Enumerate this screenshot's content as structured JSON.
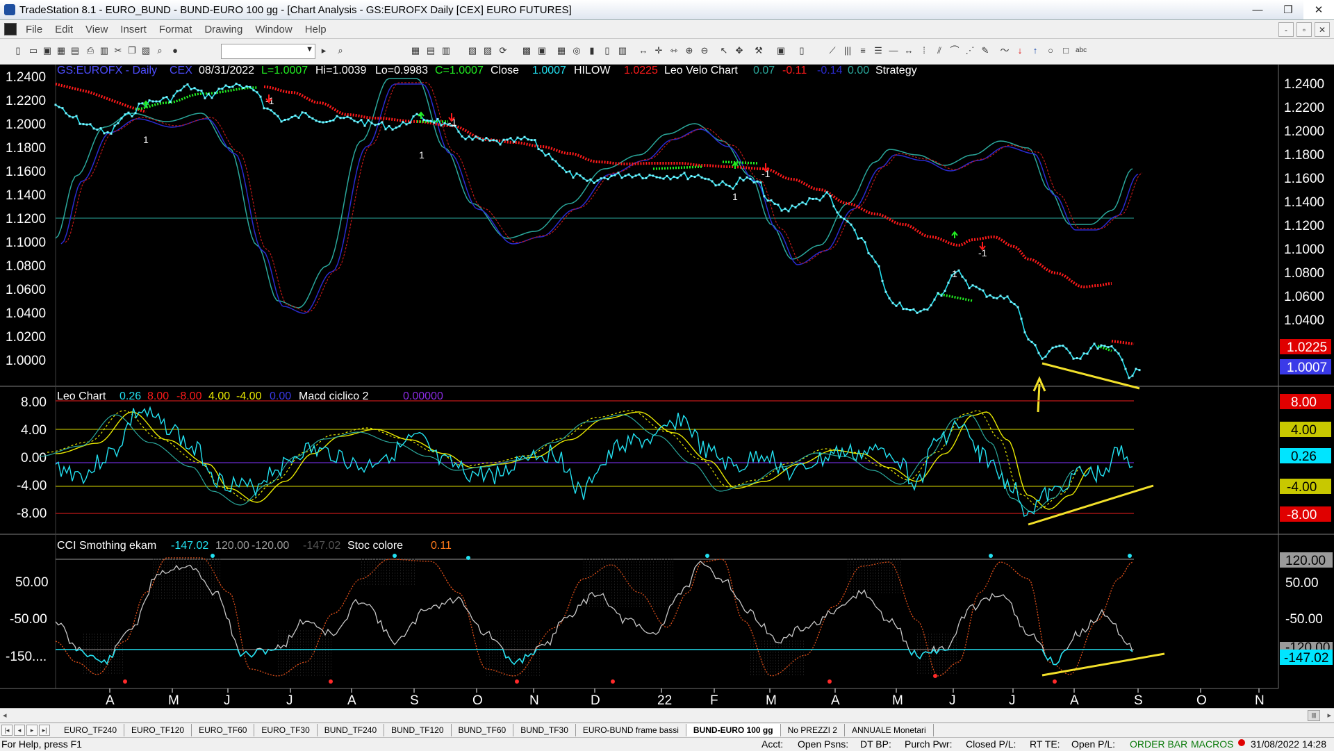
{
  "window": {
    "title": "TradeStation 8.1 - EURO_BUND - BUND-EURO 100 gg - [Chart Analysis - GS:EUROFX  Daily  [CEX] EURO FUTURES]",
    "min": "—",
    "max": "❐",
    "close": "✕"
  },
  "menu": [
    "File",
    "Edit",
    "View",
    "Insert",
    "Format",
    "Drawing",
    "Window",
    "Help"
  ],
  "mdi_buttons": [
    "-",
    "▫",
    "✕"
  ],
  "chart": {
    "header": {
      "symbol": "GS:EUROFX - Daily",
      "exchange": "CEX",
      "date": "08/31/2022",
      "L": "L=1.0007",
      "Hi": "Hi=1.0039",
      "Lo": "Lo=0.9983",
      "C": "C=1.0007",
      "close_label": "Close",
      "close_value": "1.0007",
      "hilow_label": "HILOW",
      "hilow_value": "1.0225",
      "velo_label": "Leo Velo Chart",
      "velo_v1": "0.07",
      "velo_v2": "-0.11",
      "velo_v3": "-0.14",
      "velo_v4": "0.00",
      "strategy": "Strategy"
    },
    "price_axis": [
      "1.2400",
      "1.2200",
      "1.2000",
      "1.1800",
      "1.1600",
      "1.1400",
      "1.1200",
      "1.1000",
      "1.0800",
      "1.0600",
      "1.0400",
      "1.0200",
      "1.0000"
    ],
    "price_markers": [
      {
        "label": "1.0225",
        "color": "#e00000",
        "text_color": "#ffffff"
      },
      {
        "label": "1.0007",
        "color": "#3a3ae8",
        "text_color": "#ffffff"
      }
    ],
    "leo_header": {
      "label": "Leo Chart",
      "v1": "0.26",
      "v2": "8.00",
      "v3": "-8.00",
      "v4": "4.00",
      "v5": "-4.00",
      "v6": "0.00",
      "macd": "Macd ciclico 2",
      "macd_v": "0.00000"
    },
    "leo_axis": [
      "8.00",
      "4.00",
      "0.00",
      "-4.00",
      "-8.00"
    ],
    "leo_markers": [
      {
        "label": "8.00",
        "color": "#e00000",
        "text_color": "#ffffff"
      },
      {
        "label": "4.00",
        "color": "#c8c800",
        "text_color": "#000000"
      },
      {
        "label": "0.26",
        "color": "#00e5ff",
        "text_color": "#000000"
      },
      {
        "label": "-4.00",
        "color": "#c8c800",
        "text_color": "#000000"
      },
      {
        "label": "-8.00",
        "color": "#e00000",
        "text_color": "#ffffff"
      }
    ],
    "cci_header": {
      "label": "CCI Smothing ekam",
      "v1": "-147.02",
      "v2": "120.00",
      "v3": "-120.00",
      "v4": "-147.02",
      "stoc": "Stoc colore",
      "stoc_v": "0.11"
    },
    "cci_axis": [
      "50.00",
      "-50.00",
      "-150...."
    ],
    "cci_markers": [
      {
        "label": "120.00",
        "color": "#9a9a9a",
        "text_color": "#000000"
      },
      {
        "label": "50.00",
        "color": "#000000",
        "text_color": "#ffffff"
      },
      {
        "label": "-50.00",
        "color": "#000000",
        "text_color": "#ffffff"
      },
      {
        "label": "-120.00",
        "color": "#9a9a9a",
        "text_color": "#000000"
      },
      {
        "label": "-147.02",
        "color": "#00e5ff",
        "text_color": "#000000"
      }
    ],
    "months": [
      "A",
      "M",
      "J",
      "J",
      "A",
      "S",
      "O",
      "N",
      "D",
      "22",
      "F",
      "M",
      "A",
      "M",
      "J",
      "J",
      "A",
      "S",
      "O",
      "N"
    ],
    "signal_labels": [
      "1",
      "-1",
      "1",
      "-1",
      "1",
      "-1",
      "1",
      "-1"
    ]
  },
  "tabs": [
    "EURO_TF240",
    "EURO_TF120",
    "EURO_TF60",
    "EURO_TF30",
    "BUND_TF240",
    "BUND_TF120",
    "BUND_TF60",
    "BUND_TF30",
    "EURO-BUND frame bassi",
    "BUND-EURO 100 gg",
    "No PREZZI 2",
    "ANNUALE Monetari"
  ],
  "active_tab": "BUND-EURO 100 gg",
  "status": {
    "help": "For Help, press F1",
    "acct": "Acct:",
    "open_psns": "Open Psns:",
    "dt_bp": "DT BP:",
    "purch_pwr": "Purch Pwr:",
    "closed_pl": "Closed P/L:",
    "rt_te": "RT TE:",
    "open_pl": "Open P/L:",
    "order_bar": "ORDER BAR",
    "macros": "MACROS",
    "datetime": "31/08/2022 14:28"
  },
  "colors": {
    "price_line": "#22e0f0",
    "hilow_red": "#ff1a1a",
    "hilow_green": "#22ee22",
    "velo_teal": "#2aa79b",
    "velo_blue": "#2a2ad0",
    "trend_yellow": "#f2e02a"
  }
}
